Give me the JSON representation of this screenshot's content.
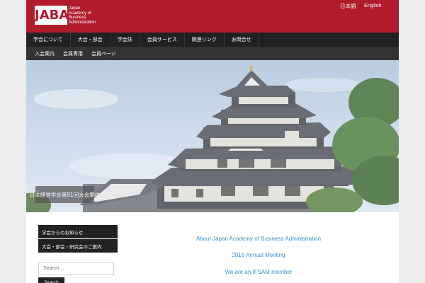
{
  "header": {
    "logo_mark": "JABA",
    "logo_lines": [
      "Japan",
      "Academy of",
      "Business",
      "Administration"
    ],
    "language_links": [
      "日本語",
      "English"
    ]
  },
  "nav": {
    "primary": [
      "学会について",
      "大会・部会",
      "学会誌",
      "会員サービス",
      "関連リンク",
      "お問合せ"
    ],
    "secondary": [
      "入会案内",
      "会員専用",
      "会員ページ"
    ]
  },
  "hero": {
    "caption": "日本経営学会第91回大会案内"
  },
  "sidebar": {
    "links": [
      "学会からのお知らせ",
      "大会・部会・研究会のご案内"
    ],
    "search_placeholder": "Search ...",
    "search_button": "Search"
  },
  "main": {
    "links": [
      "About Japan Academy of Business Administration",
      "2016 Annual Meeting",
      "We are an IFSAM member"
    ]
  },
  "colors": {
    "brand_red": "#b01b2e",
    "nav_dark": "#222222",
    "link_blue": "#3a8fd0"
  }
}
